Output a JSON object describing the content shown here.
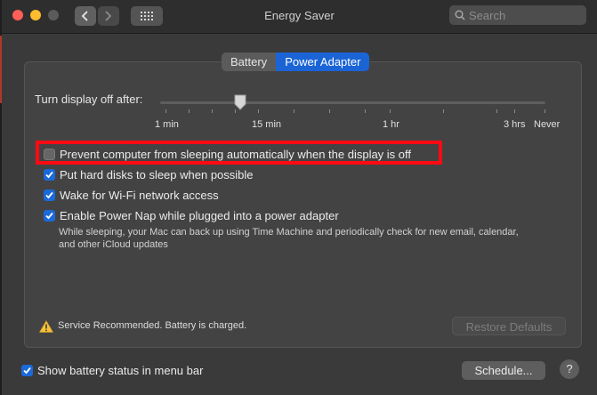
{
  "window": {
    "title": "Energy Saver"
  },
  "search": {
    "placeholder": "Search"
  },
  "tabs": [
    {
      "label": "Battery",
      "active": false
    },
    {
      "label": "Power Adapter",
      "active": true
    }
  ],
  "display_sleep": {
    "label": "Turn display off after:",
    "tick_labels": [
      "1 min",
      "15 min",
      "1 hr",
      "3 hrs",
      "Never"
    ],
    "selected": "15 min"
  },
  "options": [
    {
      "label": "Prevent computer from sleeping automatically when the display is off",
      "checked": false,
      "highlighted": true
    },
    {
      "label": "Put hard disks to sleep when possible",
      "checked": true
    },
    {
      "label": "Wake for Wi-Fi network access",
      "checked": true
    },
    {
      "label": "Enable Power Nap while plugged into a power adapter",
      "checked": true,
      "description": "While sleeping, your Mac can back up using Time Machine and periodically check for new email, calendar, and other iCloud updates"
    }
  ],
  "status": {
    "text": "Service Recommended. Battery is charged.",
    "icon": "warning-icon"
  },
  "buttons": {
    "restore_defaults": "Restore Defaults",
    "schedule": "Schedule...",
    "help": "?"
  },
  "footer": {
    "show_battery_label": "Show battery status in menu bar",
    "show_battery_checked": true
  },
  "colors": {
    "accent": "#1a64d6",
    "highlight": "#ff0a13",
    "background": "#3b3a3a"
  }
}
